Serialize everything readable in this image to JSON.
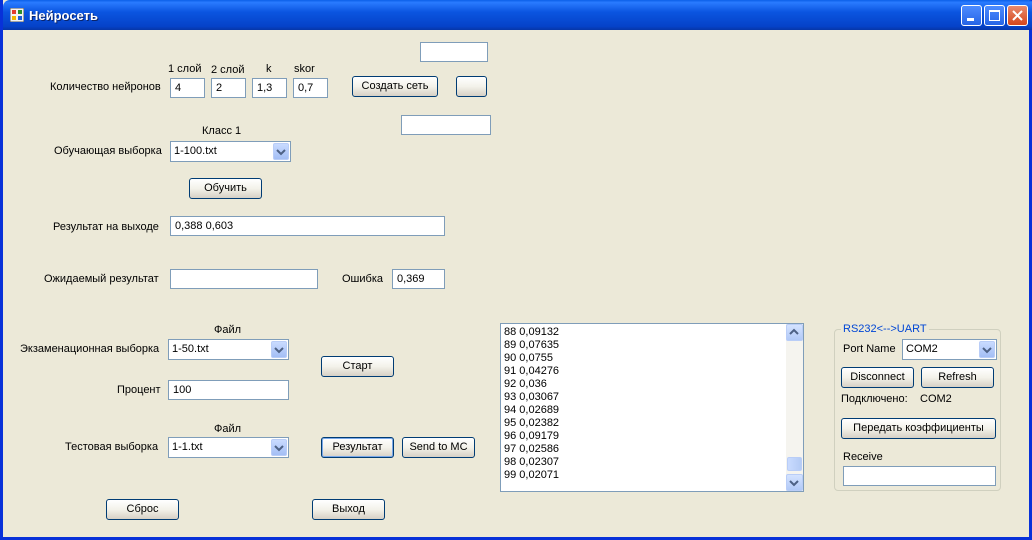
{
  "window": {
    "title": "Нейросеть"
  },
  "net": {
    "header_layer1": "1 слой",
    "header_layer2": "2 слой",
    "header_k": "k",
    "header_skor": "skor",
    "neurons_label": "Количество нейронов",
    "layer1_value": "4",
    "layer2_value": "2",
    "k_value": "1,3",
    "skor_value": "0,7",
    "create_button": "Создать сеть",
    "top_textbox": "",
    "blank_button": "",
    "mid_textbox": ""
  },
  "training": {
    "class_label": "Класс 1",
    "sample_label": "Обучающая выборка",
    "sample_selected": "1-100.txt",
    "train_button": "Обучить"
  },
  "output": {
    "result_label": "Результат на выходе",
    "result_value": "0,388   0,603",
    "expected_label": "Ожидаемый результат",
    "expected_value": "",
    "error_label": "Ошибка",
    "error_value": "0,369"
  },
  "exam": {
    "file_label": "Файл",
    "sample_label": "Экзаменационная выборка",
    "sample_selected": "1-50.txt",
    "start_button": "Старт",
    "percent_label": "Процент",
    "percent_value": "100"
  },
  "test": {
    "file_label": "Файл",
    "sample_label": "Тестовая выборка",
    "sample_selected": "1-1.txt",
    "result_button": "Результат",
    "send_button": "Send to MC"
  },
  "bottom": {
    "reset_button": "Сброс",
    "exit_button": "Выход"
  },
  "log": {
    "lines": [
      "88  0,09132",
      "89  0,07635",
      "90  0,0755",
      "91  0,04276",
      "92  0,036",
      "93  0,03067",
      "94  0,02689",
      "95  0,02382",
      "96  0,09179",
      "97  0,02586",
      "98  0,02307",
      "99  0,02071"
    ]
  },
  "serial": {
    "group_title": "RS232<-->UART",
    "port_label": "Port Name",
    "port_selected": "COM2",
    "disconnect_button": "Disconnect",
    "refresh_button": "Refresh",
    "connected_label": "Подключено:",
    "connected_value": "COM2",
    "send_coeffs_button": "Передать коэффициенты",
    "receive_label": "Receive",
    "receive_value": ""
  },
  "colors": {
    "title_bar": "#0a5fe8",
    "window_bg": "#ece9d8",
    "group_title": "#0046d5",
    "close_button": "#d6461c"
  }
}
